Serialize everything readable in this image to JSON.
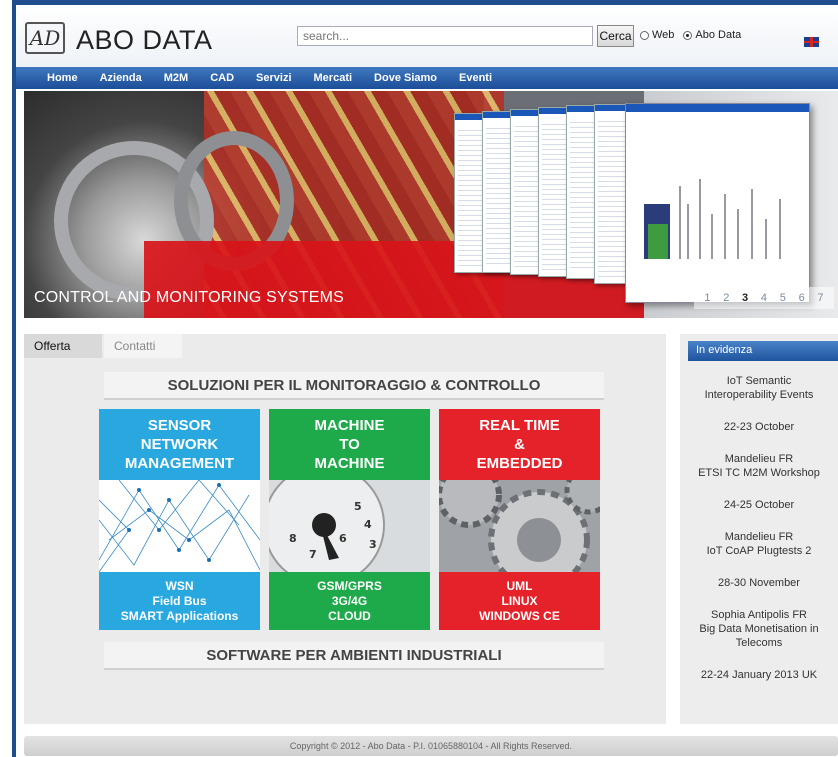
{
  "header": {
    "logo_mark": "AD",
    "title": "ABO DATA",
    "search_placeholder": "search...",
    "search_button": "Cerca",
    "radio_web": "Web",
    "radio_abo": "Abo Data",
    "radio_selected": "Abo Data",
    "language_flag_icon": "uk-flag-icon"
  },
  "nav": [
    "Home",
    "Azienda",
    "M2M",
    "CAD",
    "Servizi",
    "Mercati",
    "Dove Siamo",
    "Eventi"
  ],
  "banner": {
    "caption": "CONTROL AND MONITORING SYSTEMS",
    "pages": [
      "1",
      "2",
      "3",
      "4",
      "5",
      "6",
      "7"
    ],
    "active_page": "3"
  },
  "tabs": {
    "offerta": "Offerta",
    "contatti": "Contatti"
  },
  "main": {
    "title_top": "SOLUZIONI PER IL MONITORAGGIO & CONTROLLO",
    "title_bottom": "SOFTWARE PER AMBIENTI INDUSTRIALI",
    "tiles": [
      {
        "top": [
          "SENSOR",
          "NETWORK",
          "MANAGEMENT"
        ],
        "bottom": [
          "WSN",
          "Field Bus",
          "SMART Applications"
        ],
        "color": "#29a8e0"
      },
      {
        "top": [
          "MACHINE",
          "TO",
          "MACHINE"
        ],
        "bottom": [
          "GSM/GPRS",
          "3G/4G",
          "CLOUD"
        ],
        "color": "#1eaa4a"
      },
      {
        "top": [
          "REAL TIME",
          "&",
          "EMBEDDED"
        ],
        "bottom": [
          "UML",
          "LINUX",
          "WINDOWS CE"
        ],
        "color": "#e5222a"
      }
    ]
  },
  "sidebar": {
    "heading": "In evidenza",
    "items": [
      "IoT Semantic",
      "Interoperability Events",
      "22-23 October",
      "Mandelieu FR",
      "ETSI TC M2M Workshop",
      "24-25 October",
      "Mandelieu FR",
      "IoT CoAP Plugtests 2",
      "28-30 November",
      "Sophia Antipolis FR",
      "Big Data Monetisation in",
      "Telecoms",
      "22-24 January 2013 UK"
    ]
  },
  "footer": {
    "text": "Copyright © 2012 - Abo Data - P.I. 01065880104 - All Rights Reserved."
  }
}
